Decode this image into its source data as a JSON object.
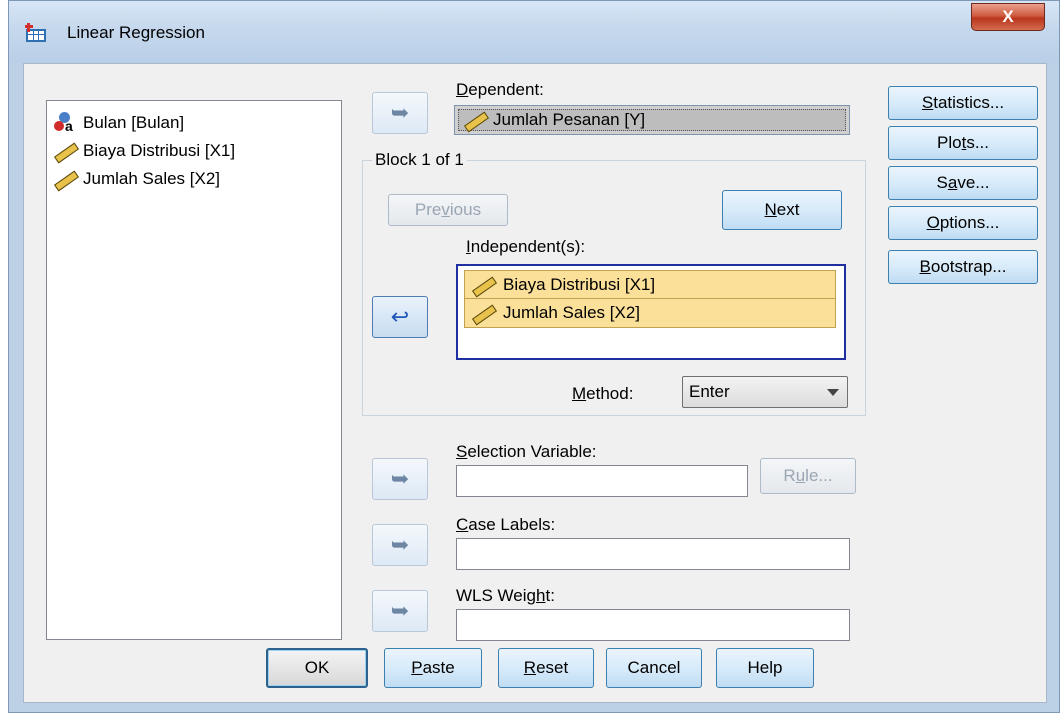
{
  "window": {
    "title": "Linear Regression",
    "close_glyph": "X"
  },
  "source_variables": [
    {
      "label": "Bulan [Bulan]",
      "icon": "nominal-variable-icon"
    },
    {
      "label": "Biaya Distribusi [X1]",
      "icon": "scale-ruler-icon"
    },
    {
      "label": "Jumlah Sales [X2]",
      "icon": "scale-ruler-icon"
    }
  ],
  "dependent": {
    "label": "Dependent:",
    "value": "Jumlah Pesanan [Y]"
  },
  "block": {
    "legend": "Block 1 of 1",
    "previous_label": "Previous",
    "next_label": "Next",
    "independents_label": "Independent(s):",
    "independents": [
      "Biaya Distribusi [X1]",
      "Jumlah Sales [X2]"
    ],
    "method_label": "Method:",
    "method_value": "Enter"
  },
  "selection_variable": {
    "label": "Selection Variable:",
    "rule_label": "Rule..."
  },
  "case_labels": {
    "label": "Case Labels:"
  },
  "wls_weight": {
    "label": "WLS Weight:"
  },
  "side_buttons": {
    "statistics": "Statistics...",
    "plots": "Plots...",
    "save": "Save...",
    "options": "Options...",
    "bootstrap": "Bootstrap..."
  },
  "footer_buttons": {
    "ok": "OK",
    "paste": "Paste",
    "reset": "Reset",
    "cancel": "Cancel",
    "help": "Help"
  },
  "colors": {
    "highlight": "#fbe09a",
    "window_frame": "#bcd0e6",
    "client": "#f0f0f0",
    "close_button": "#c9462b"
  }
}
